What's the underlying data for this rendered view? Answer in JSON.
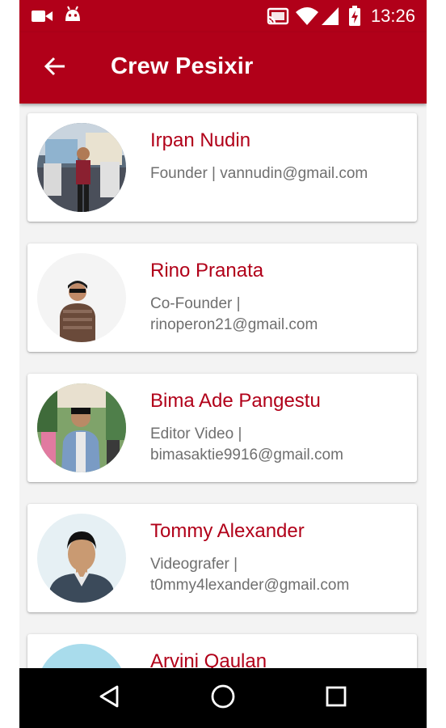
{
  "status_bar": {
    "time": "13:26",
    "icons": [
      "video-camera-icon",
      "android-icon",
      "cast-icon",
      "wifi-icon",
      "signal-icon",
      "battery-charging-icon"
    ]
  },
  "app_bar": {
    "back_icon": "arrow-left-icon",
    "title": "Crew Pesixir"
  },
  "crew": [
    {
      "name": "Irpan Nudin",
      "role": "Founder | vannudin@gmail.com"
    },
    {
      "name": "Rino Pranata",
      "role": "Co-Founder | rinoperon21@gmail.com"
    },
    {
      "name": "Bima Ade Pangestu",
      "role": "Editor Video | bimasaktie9916@gmail.com"
    },
    {
      "name": "Tommy Alexander",
      "role": "Videografer | t0mmy4lexander@gmail.com"
    },
    {
      "name": "Arvini Qaulan",
      "role": ""
    }
  ],
  "nav_bar": {
    "icons": [
      "back-triangle-icon",
      "home-circle-icon",
      "recents-square-icon"
    ]
  },
  "colors": {
    "primary": "#b10019",
    "name_text": "#b10019",
    "secondary_text": "#6f6f6f",
    "background": "#f3f3f3"
  }
}
